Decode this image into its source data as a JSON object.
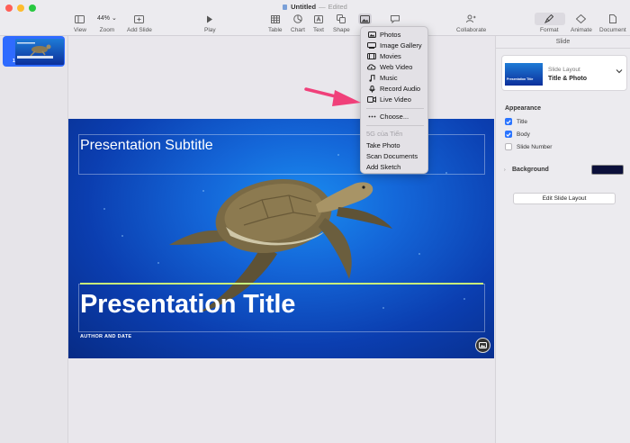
{
  "window": {
    "title": "Untitled",
    "separator": "—",
    "status": "Edited"
  },
  "toolbar": {
    "view_label": "View",
    "zoom_value": "44%",
    "zoom_label": "Zoom",
    "add_slide_label": "Add Slide",
    "play_label": "Play",
    "table_label": "Table",
    "chart_label": "Chart",
    "text_label": "Text",
    "shape_label": "Shape",
    "media_label": "M",
    "comment_label": "",
    "collaborate_label": "Collaborate",
    "format_label": "Format",
    "animate_label": "Animate",
    "document_label": "Document"
  },
  "sidebar": {
    "slides": [
      {
        "number": "1"
      }
    ]
  },
  "slide": {
    "subtitle": "Presentation Subtitle",
    "title": "Presentation Title",
    "author": "AUTHOR AND DATE"
  },
  "media_menu": {
    "items": [
      {
        "label": "Photos",
        "icon": "photo-icon"
      },
      {
        "label": "Image Gallery",
        "icon": "gallery-icon"
      },
      {
        "label": "Movies",
        "icon": "movie-icon"
      },
      {
        "label": "Web Video",
        "icon": "web-video-icon"
      },
      {
        "label": "Music",
        "icon": "music-icon"
      },
      {
        "label": "Record Audio",
        "icon": "microphone-icon"
      },
      {
        "label": "Live Video",
        "icon": "live-video-icon"
      }
    ],
    "choose_label": "Choose...",
    "device_header": "5G của Tiến",
    "device_items": [
      "Take Photo",
      "Scan Documents",
      "Add Sketch"
    ]
  },
  "panel": {
    "header": "Slide",
    "layout_label": "Slide Layout",
    "layout_value": "Title & Photo",
    "layout_thumb_title": "Presentation Title",
    "appearance_title": "Appearance",
    "checkboxes": [
      {
        "label": "Title",
        "checked": true
      },
      {
        "label": "Body",
        "checked": true
      },
      {
        "label": "Slide Number",
        "checked": false
      }
    ],
    "background_label": "Background",
    "background_color": "#0b0f3a",
    "edit_layout_label": "Edit Slide Layout"
  },
  "colors": {
    "accent": "#2a74ff",
    "annotation_arrow": "#f0407a"
  }
}
